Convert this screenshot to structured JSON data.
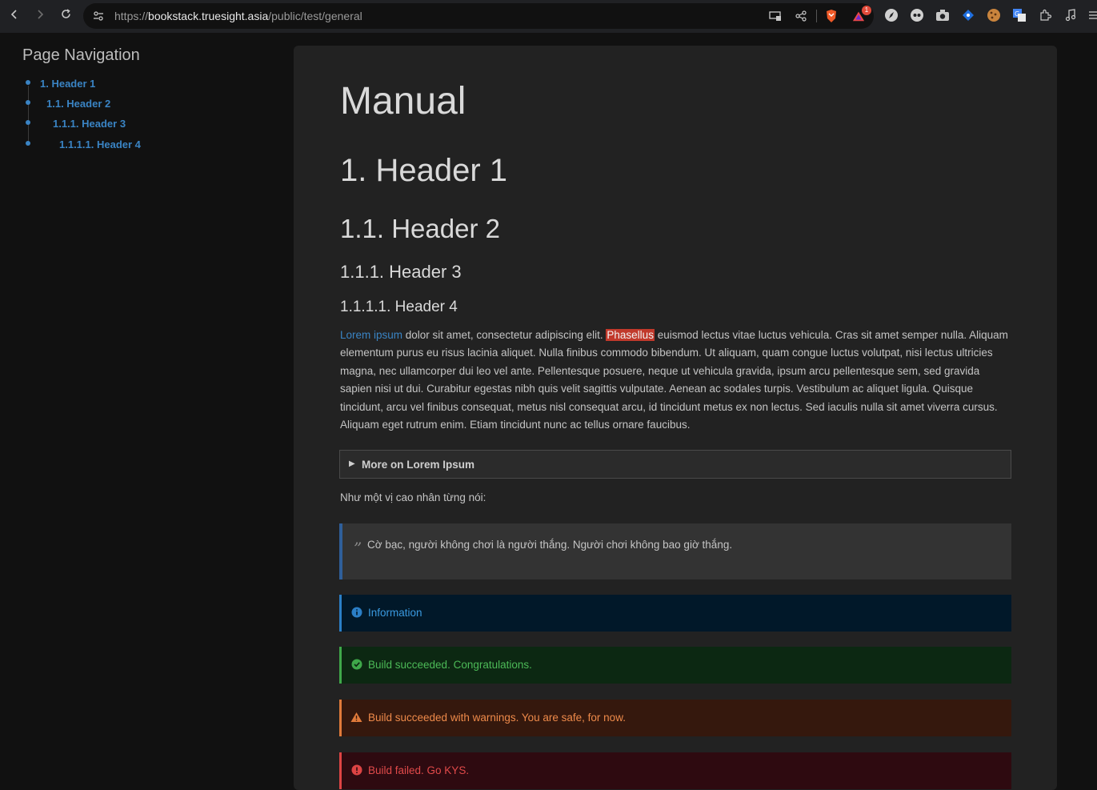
{
  "browser": {
    "url_prefix": "https://",
    "url_host": "bookstack.truesight.asia",
    "url_path": "/public/test/general",
    "extension_badge": "1"
  },
  "sidebar": {
    "title": "Page Navigation",
    "items": [
      {
        "label": "1. Header 1"
      },
      {
        "label": "1.1. Header 2"
      },
      {
        "label": "1.1.1. Header 3"
      },
      {
        "label": "1.1.1.1. Header 4"
      }
    ]
  },
  "page": {
    "title": "Manual",
    "h1": "1. Header 1",
    "h2": "1.1. Header 2",
    "h3": "1.1.1. Header 3",
    "h4": "1.1.1.1. Header 4",
    "paragraph": {
      "link_text": "Lorem ipsum",
      "text_a": " dolor sit amet, consectetur adipiscing elit. ",
      "highlight": "Phasellus",
      "text_b": " euismod lectus vitae luctus vehicula. Cras sit amet semper nulla. Aliquam elementum purus eu risus lacinia aliquet. Nulla finibus commodo bibendum. Ut aliquam, quam congue luctus volutpat, nisi lectus ultricies magna, nec ullamcorper dui leo vel ante. Pellentesque posuere, neque ut vehicula gravida, ipsum arcu pellentesque sem, sed gravida sapien nisi ut dui. Curabitur egestas nibh quis velit sagittis vulputate. Aenean ac sodales turpis. Vestibulum ac aliquet ligula. Quisque tincidunt, arcu vel finibus consequat, metus nisl consequat arcu, id tincidunt metus ex non lectus. Sed iaculis nulla sit amet viverra cursus. Aliquam eget rutrum enim. Etiam tincidunt nunc ac tellus ornare faucibus."
    },
    "details_summary": "More on Lorem Ipsum",
    "quote_intro": "Như một vị cao nhân từng nói:",
    "quote_mark": "”",
    "quote_text": "Cờ bạc, người không chơi là người thắng. Người chơi không bao giờ thắng.",
    "callouts": {
      "info": "Information",
      "success": "Build succeeded. Congratulations.",
      "warning": "Build succeeded with warnings. You are safe, for now.",
      "danger": "Build failed. Go KYS."
    }
  },
  "colors": {
    "link": "#3a84c4",
    "highlight": "#c1392b",
    "info": "#3a9ae0",
    "success": "#4cba57",
    "warning": "#ee8a4a",
    "danger": "#e14a4a"
  }
}
